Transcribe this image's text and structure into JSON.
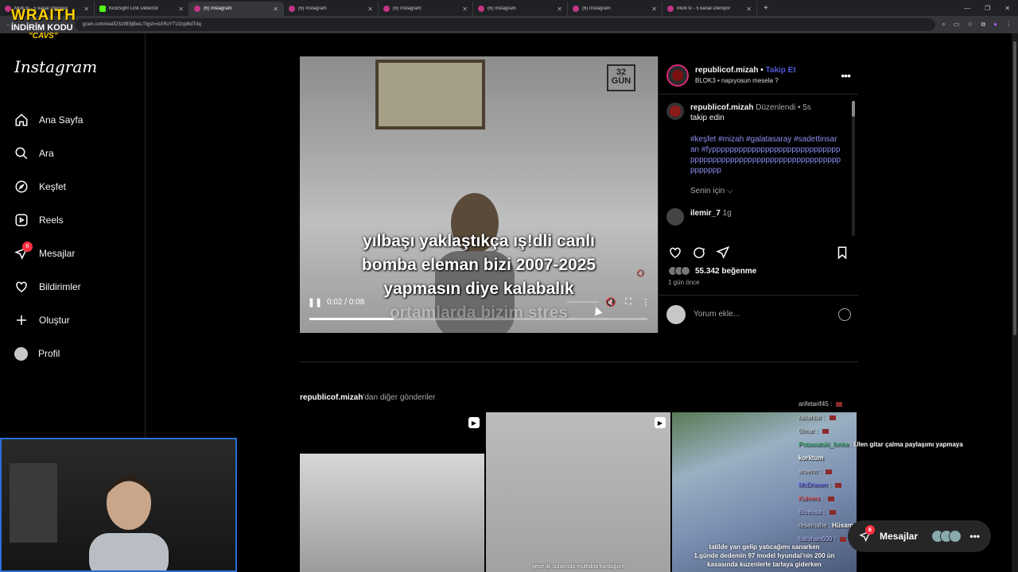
{
  "browser": {
    "tabs": [
      {
        "title": "Multi tv - 5 kanal izleniyor",
        "active": false
      },
      {
        "title": "KickSight Link Detector",
        "active": false
      },
      {
        "title": "(6) Instagram",
        "active": true
      },
      {
        "title": "(6) Instagram",
        "active": false
      },
      {
        "title": "(6) Instagram",
        "active": false
      },
      {
        "title": "(6) Instagram",
        "active": false
      },
      {
        "title": "(6) Instagram",
        "active": false
      },
      {
        "title": "Multi tv - 5 kanal izleniyor",
        "active": false
      }
    ],
    "url": "gram.com/reel/DSz9EltjBwL/?igsh=bXRzYTU2cjd6dTdq"
  },
  "overlay": {
    "line1": "WRAITH",
    "line2": "İNDİRİM KODU",
    "line3": "\"CAVS\""
  },
  "sidebar": {
    "brand": "Instagram",
    "items": [
      {
        "label": "Ana Sayfa",
        "icon": "home-icon"
      },
      {
        "label": "Ara",
        "icon": "search-icon"
      },
      {
        "label": "Keşfet",
        "icon": "compass-icon"
      },
      {
        "label": "Reels",
        "icon": "reels-icon"
      },
      {
        "label": "Mesajlar",
        "icon": "messages-icon",
        "badge": "6"
      },
      {
        "label": "Bildirimler",
        "icon": "heart-icon"
      },
      {
        "label": "Oluştur",
        "icon": "plus-icon"
      },
      {
        "label": "Profil",
        "icon": "avatar"
      }
    ]
  },
  "video": {
    "stamp": "32 GÜN",
    "caption": [
      "yılbaşı yaklaştıkça ış!dli canlı",
      "bomba eleman bizi 2007-2025",
      "yapmasın diye kalabalık",
      "ortamlarda bizim stres"
    ],
    "time": "0:02 / 0:08",
    "progress": 0.25
  },
  "post": {
    "username": "republicof.mizah",
    "follow": "Takip Et",
    "audio": "BLOK3 • napıyosun mesela ?",
    "caption_user": "republicof.mizah",
    "edited": "Düzenlendi • 5s",
    "caption_text": "takip edin",
    "hashtags": "#keşfet #mizah #galatasaray #sadettinsaran #fypppppppppppppppppppppppppppppppppppppppppppppppppppppppppppppppppppppp",
    "for_you": "Senin için ⌵",
    "comment_user": "ilemir_7",
    "comment_time": "1g",
    "likes": "55.342 beğenme",
    "ago": "1 gün önce",
    "add_comment": "Yorum ekle..."
  },
  "more": {
    "user": "republicof.mizah",
    "suffix": "'dan diğer gönderiler",
    "captions": [
      "gece iki sularında mutfakta kurduğum",
      "tatilde yan gelip yatıcağımı sanarken\n1.günde dedemin 97 model hyundai'nin 200 ün\nkasasında kuzenlerle tarlaya giderken"
    ]
  },
  "chat": [
    {
      "user": "arifetarif45",
      "text": "",
      "cls": "u2"
    },
    {
      "user": "rakanlar",
      "text": "",
      "cls": "u2"
    },
    {
      "user": "0lmar",
      "text": "",
      "cls": "u2"
    },
    {
      "user": "Potawatoki_fonka",
      "text": "Ulen gitar çalma paylaşımı yapmaya",
      "cls": "u3"
    },
    {
      "user": "",
      "text": "korktum",
      "cls": "u2"
    },
    {
      "user": "arvenn",
      "text": "",
      "cls": "u2"
    },
    {
      "user": "McDraven",
      "text": "",
      "cls": "u4"
    },
    {
      "user": "Kulvera",
      "text": "",
      "cls": "u5"
    },
    {
      "user": "Blueosa",
      "text": "",
      "cls": "u1"
    },
    {
      "user": "resemahe",
      "text": "Hüsam kesitleri fena sarıyor",
      "cls": "u2"
    },
    {
      "user": "",
      "text": "",
      "cls": "u2"
    },
    {
      "user": "batuhan600",
      "text": "",
      "cls": "u1"
    }
  ],
  "messages_pill": {
    "label": "Mesajlar",
    "badge": "6"
  }
}
